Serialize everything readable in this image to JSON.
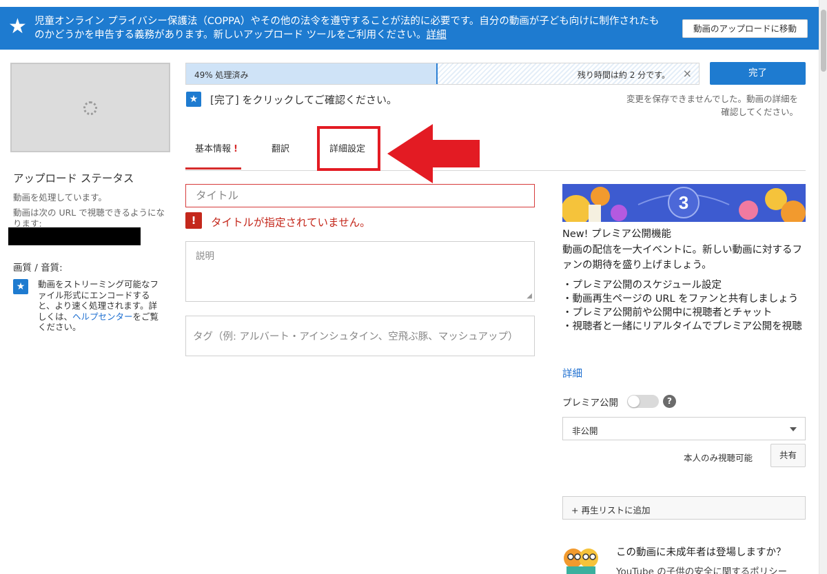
{
  "banner": {
    "message": "児童オンライン プライバシー保護法（COPPA）やその他の法令を遵守することが法的に必要です。自分の動画が子ども向けに制作されたものかどうかを申告する義務があります。新しいアップロード ツールをご利用ください。",
    "details_link": "詳細",
    "move_button": "動画のアップロードに移動"
  },
  "left": {
    "upload_status_title": "アップロード ステータス",
    "processing_text": "動画を処理しています。",
    "url_text": "動画は次の URL で視聴できるようになります:",
    "quality_title": "画質 / 音質:",
    "quality_text": "動画をストリーミング可能なファイル形式にエンコードすると、より速く処理されます。詳しくは、",
    "help_center_link": "ヘルプセンター",
    "quality_text_tail": "をご覧ください。"
  },
  "progress": {
    "percent": 0.49,
    "percent_label": "49% 処理済み",
    "remaining": "残り時間は約 2 分です。",
    "close_symbol": "×",
    "done_button": "完了"
  },
  "confirm_text": "[完了] をクリックしてご確認ください。",
  "save_error": "変更を保存できませんでした。動画の詳細を確認してください。",
  "tabs": [
    {
      "label": "基本情報",
      "alert": "!"
    },
    {
      "label": "翻訳"
    },
    {
      "label": "詳細設定"
    }
  ],
  "form": {
    "title_placeholder": "タイトル",
    "title_error_icon": "!",
    "title_error": "タイトルが指定されていません。",
    "description_placeholder": "説明",
    "tags_placeholder": "タグ（例: アルバート・アインシュタイン、空飛ぶ豚、マッシュアップ）"
  },
  "premiere": {
    "banner_number": "3",
    "title": "New! プレミア公開機能",
    "description": "動画の配信を一大イベントに。新しい動画に対するファンの期待を盛り上げましょう。",
    "bullets": [
      "・プレミア公開のスケジュール設定",
      "・動画再生ページの URL をファンと共有しましょう",
      "・プレミア公開前や公開中に視聴者とチャット",
      "・視聴者と一緒にリアルタイムでプレミア公開を視聴"
    ],
    "details_link": "詳細",
    "toggle_label": "プレミア公開",
    "toggle_on": false,
    "help_symbol": "?"
  },
  "visibility": {
    "selected": "非公開",
    "note": "本人のみ視聴可能",
    "share_button": "共有"
  },
  "playlist_button": "+ 再生リストに追加",
  "minors": {
    "question": "この動画に未成年者は登場しますか？",
    "subtext": "YouTube の子供の安全に関するポリシー"
  },
  "icons": {
    "banner": "star-icon",
    "confirm": "star-icon",
    "quality": "star-icon",
    "spinner": "loading-spinner-icon",
    "annotation": "red-arrow-icon"
  },
  "colors": {
    "accent": "#1e7bd0",
    "error": "#c4281c",
    "annotation": "#e31b23"
  }
}
